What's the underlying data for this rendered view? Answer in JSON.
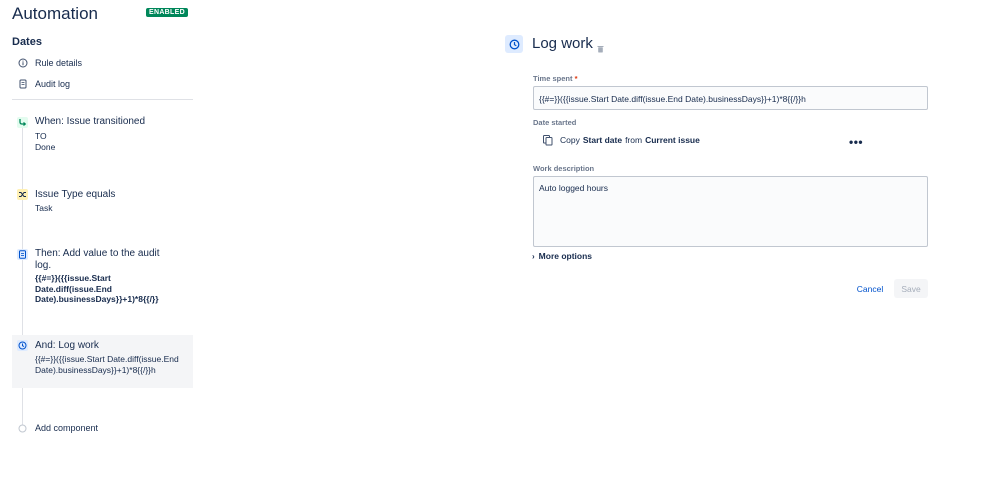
{
  "header": {
    "title": "Automation",
    "status_badge": "ENABLED"
  },
  "rule": {
    "name": "Dates"
  },
  "nav": {
    "rule_details": "Rule details",
    "audit_log": "Audit log"
  },
  "components": {
    "trigger": {
      "title": "When: Issue transitioned",
      "to_label": "TO",
      "to_value": "Done"
    },
    "condition": {
      "title": "Issue Type equals",
      "value": "Task"
    },
    "action_audit": {
      "title": "Then: Add value to the audit log.",
      "value": "{{#=}}({{issue.Start Date.diff(issue.End Date).businessDays}}+1)*8{{/}}"
    },
    "action_log": {
      "title": "And: Log work",
      "value": "{{#=}}({{issue.Start Date.diff(issue.End Date).businessDays}}+1)*8{{/}}h"
    },
    "add": {
      "label": "Add component"
    }
  },
  "panel": {
    "title": "Log work",
    "time_spent": {
      "label": "Time spent",
      "required_mark": "*",
      "value": "{{#=}}({{issue.Start Date.diff(issue.End Date).businessDays}}+1)*8{{/}}h"
    },
    "date_started": {
      "label": "Date started",
      "prefix": "Copy",
      "field": "Start date",
      "middle": "from",
      "source": "Current issue",
      "more": "•••"
    },
    "work_description": {
      "label": "Work description",
      "value": "Auto logged hours"
    },
    "more_options": "More options",
    "cancel": "Cancel",
    "save": "Save"
  },
  "colors": {
    "accent": "#0052cc",
    "enabled": "#00875a",
    "trigger_icon": "#e3fcef",
    "condition_icon": "#fff0b3",
    "action_icon": "#deebff"
  },
  "icons": {
    "rule_details": "info-icon",
    "audit_log": "document-icon",
    "trigger": "branch-icon",
    "condition": "shuffle-icon",
    "action": "document-icon",
    "log_work": "clock-icon",
    "trash": "trash-icon",
    "copy": "copy-icon"
  }
}
